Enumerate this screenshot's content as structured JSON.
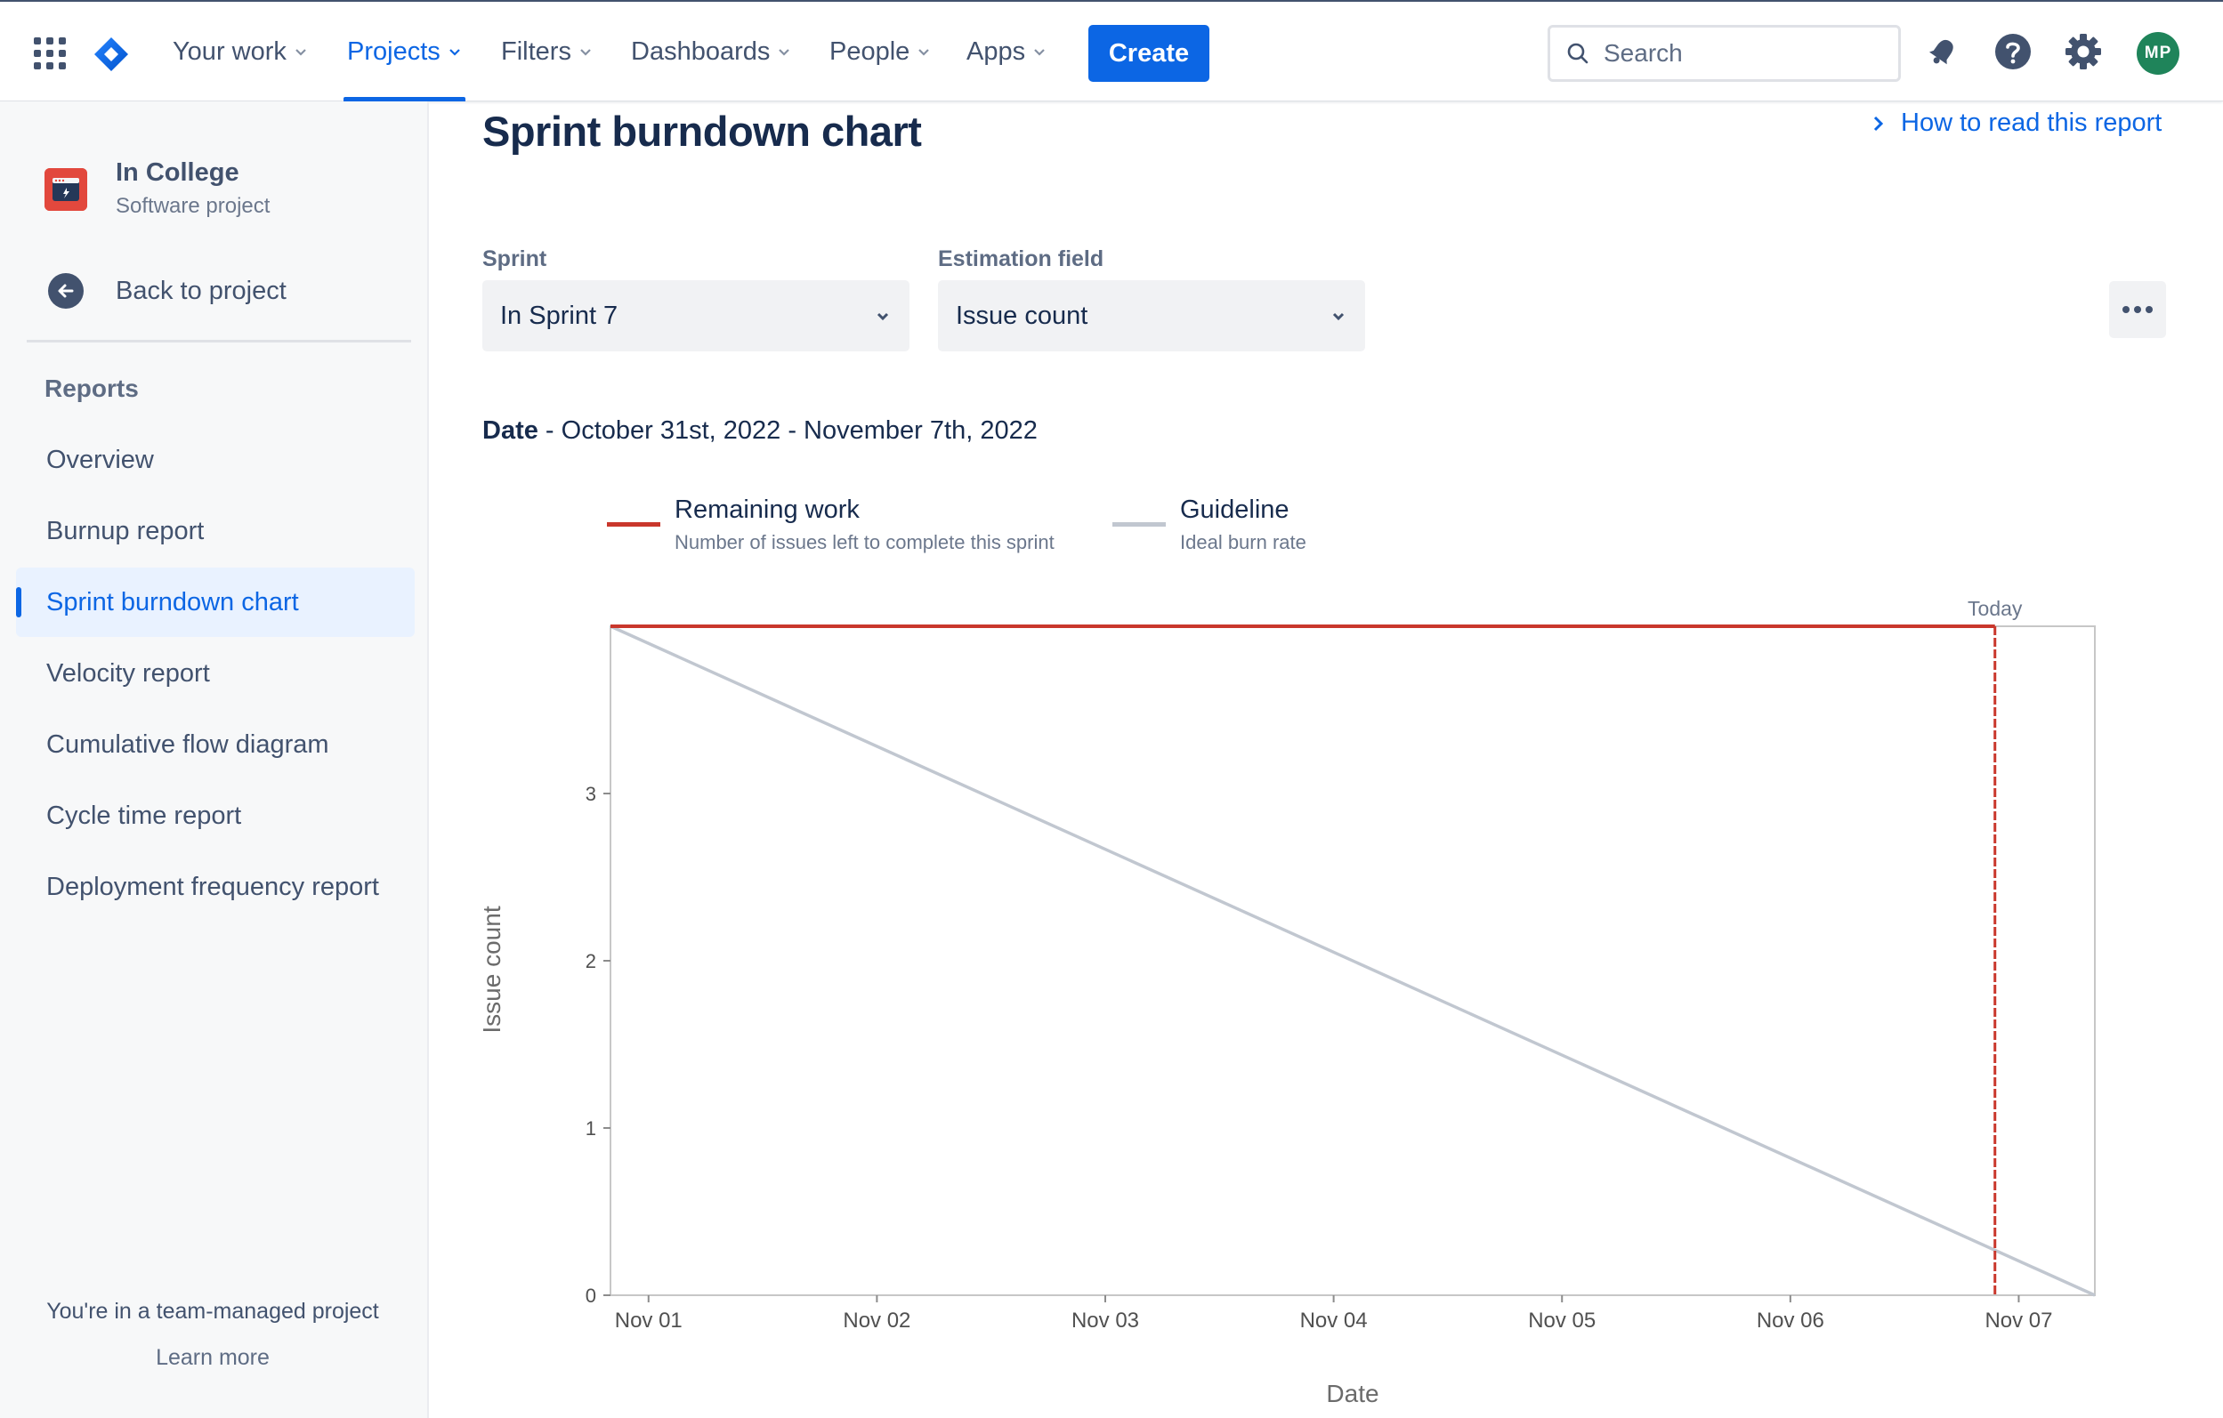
{
  "nav": {
    "items": [
      {
        "label": "Your work",
        "active": false
      },
      {
        "label": "Projects",
        "active": true
      },
      {
        "label": "Filters",
        "active": false
      },
      {
        "label": "Dashboards",
        "active": false
      },
      {
        "label": "People",
        "active": false
      },
      {
        "label": "Apps",
        "active": false
      }
    ],
    "create_label": "Create",
    "search_placeholder": "Search",
    "avatar_initials": "MP",
    "accent_color": "#0c66e4"
  },
  "sidebar": {
    "project_name": "In College",
    "project_type": "Software project",
    "back_label": "Back to project",
    "reports_heading": "Reports",
    "items": [
      {
        "label": "Overview",
        "active": false
      },
      {
        "label": "Burnup report",
        "active": false
      },
      {
        "label": "Sprint burndown chart",
        "active": true
      },
      {
        "label": "Velocity report",
        "active": false
      },
      {
        "label": "Cumulative flow diagram",
        "active": false
      },
      {
        "label": "Cycle time report",
        "active": false
      },
      {
        "label": "Deployment frequency report",
        "active": false
      }
    ],
    "footer_text": "You're in a team-managed project",
    "footer_link": "Learn more"
  },
  "main": {
    "title": "Sprint burndown chart",
    "help_link": "How to read this report",
    "sprint_label": "Sprint",
    "sprint_value": "In Sprint 7",
    "estimation_label": "Estimation field",
    "estimation_value": "Issue count",
    "date_label": "Date",
    "date_range": " - October 31st, 2022 - November 7th, 2022"
  },
  "chart_data": {
    "type": "line",
    "xlabel": "Date",
    "ylabel": "Issue count",
    "x_ticks": [
      "Nov 01",
      "Nov 02",
      "Nov 03",
      "Nov 04",
      "Nov 05",
      "Nov 06",
      "Nov 07"
    ],
    "y_ticks": [
      0,
      1,
      2,
      3
    ],
    "xlim": [
      "2022-10-31T20:00",
      "2022-11-07T08:00"
    ],
    "ylim": [
      0,
      4
    ],
    "grid": false,
    "legend_position": "top-left",
    "today_label": "Today",
    "today": "2022-11-06T21:30",
    "series": [
      {
        "name": "Remaining work",
        "description": "Number of issues left to complete this sprint",
        "color": "#c9372c",
        "points": [
          {
            "x": "2022-10-31T20:00",
            "y": 4
          },
          {
            "x": "2022-11-06T21:30",
            "y": 4
          }
        ]
      },
      {
        "name": "Guideline",
        "description": "Ideal burn rate",
        "color": "#c1c7d0",
        "points": [
          {
            "x": "2022-10-31T20:00",
            "y": 4
          },
          {
            "x": "2022-11-07T08:00",
            "y": 0
          }
        ]
      }
    ]
  }
}
